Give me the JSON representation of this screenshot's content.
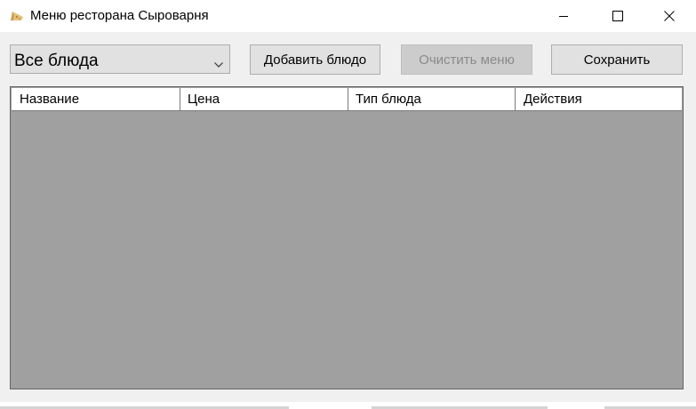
{
  "window": {
    "title": "Меню ресторана Сыроварня",
    "icon": "cheese-app-icon"
  },
  "toolbar": {
    "category_filter": {
      "selected": "Все блюда"
    },
    "add_label": "Добавить блюдо",
    "clear_label": "Очистить меню",
    "clear_enabled": false,
    "save_label": "Сохранить"
  },
  "grid": {
    "columns": [
      "Название",
      "Цена",
      "Тип блюда",
      "Действия"
    ],
    "rows": []
  },
  "colors": {
    "grid_background": "#a0a0a0",
    "button_face": "#e1e1e1",
    "disabled_text": "#8a8a8a"
  }
}
